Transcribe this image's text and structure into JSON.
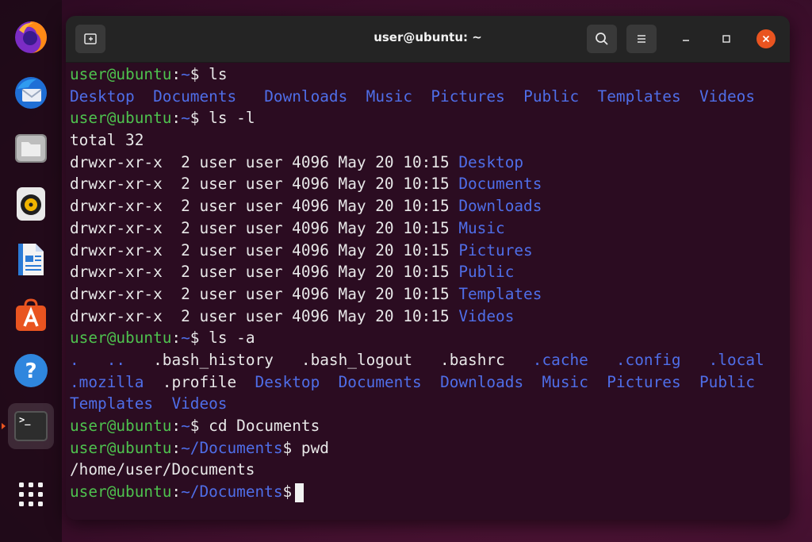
{
  "window": {
    "title": "user@ubuntu: ~"
  },
  "dock": {
    "items": [
      {
        "name": "firefox",
        "icon": "firefox-icon"
      },
      {
        "name": "thunderbird",
        "icon": "mail-icon"
      },
      {
        "name": "files",
        "icon": "folder-icon"
      },
      {
        "name": "rhythmbox",
        "icon": "music-player-icon"
      },
      {
        "name": "writer",
        "icon": "document-icon"
      },
      {
        "name": "software",
        "icon": "app-store-icon"
      },
      {
        "name": "help",
        "icon": "help-icon"
      },
      {
        "name": "terminal",
        "icon": "terminal-icon"
      },
      {
        "name": "show-apps",
        "icon": "apps-grid-icon"
      }
    ],
    "terminal_icon_text": ">_",
    "help_glyph": "?"
  },
  "colors": {
    "prompt_user": "#4ec24e",
    "prompt_path": "#4f6ee8",
    "directory": "#4f6ee8",
    "text": "#e8e8e8",
    "accent": "#e95420"
  },
  "prompt": {
    "userhost": "user@ubuntu",
    "colon": ":",
    "home": "~",
    "docs": "~/Documents",
    "dollar": "$"
  },
  "commands": {
    "c1": " ls",
    "c2": " ls -l",
    "c3": " ls -a",
    "c4": " cd Documents",
    "c5": " pwd",
    "c6": " "
  },
  "ls_output": [
    "Desktop",
    "Documents",
    "Downloads",
    "Music",
    "Pictures",
    "Public",
    "Templates",
    "Videos"
  ],
  "ls_l": {
    "total": "total 32",
    "meta": "drwxr-xr-x  2 user user 4096 May 20 10:15 ",
    "entries": [
      "Desktop",
      "Documents",
      "Downloads",
      "Music",
      "Pictures",
      "Public",
      "Templates",
      "Videos"
    ]
  },
  "ls_a": {
    "line1_dirs_a": [
      ".",
      ".."
    ],
    "line1_files": [
      ".bash_history",
      ".bash_logout",
      ".bashrc"
    ],
    "line1_dirs_b": [
      ".cache",
      ".config",
      ".local"
    ],
    "line2_dir_a": ".mozilla",
    "line2_file": ".profile",
    "line2_dirs": [
      "Desktop",
      "Documents",
      "Downloads",
      "Music",
      "Pictures",
      "Public"
    ],
    "line3_dirs": [
      "Templates",
      "Videos"
    ]
  },
  "pwd_output": "/home/user/Documents"
}
